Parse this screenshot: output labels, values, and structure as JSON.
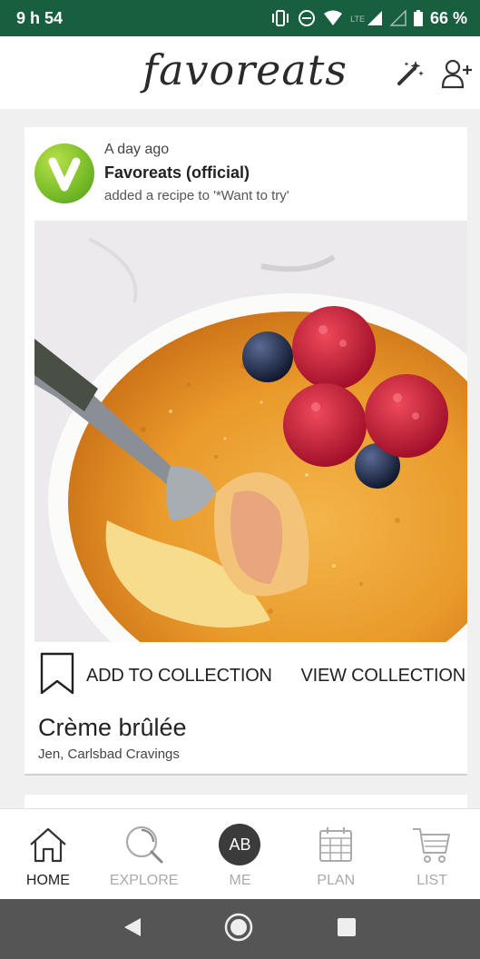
{
  "status_bar": {
    "time": "9 h 54",
    "network": "LTE",
    "battery": "66 %"
  },
  "header": {
    "logo": "favoreats",
    "icons": [
      "magic-wand-icon",
      "add-friend-icon"
    ]
  },
  "feed": {
    "card": {
      "time": "A day ago",
      "author": "Favoreats (official)",
      "action": "added a recipe to '*Want to try'",
      "add_label": "ADD TO COLLECTION",
      "view_label": "VIEW COLLECTION",
      "recipe_title": "Crème brûlée",
      "recipe_source": "Jen, Carlsbad Cravings"
    }
  },
  "nav": {
    "home": "HOME",
    "explore": "EXPLORE",
    "me_initials": "AB",
    "me": "ME",
    "plan": "PLAN",
    "list": "LIST"
  },
  "colors": {
    "status_bar": "#175f3f",
    "android_nav": "#555555",
    "avatar": "#7cbf2a"
  }
}
